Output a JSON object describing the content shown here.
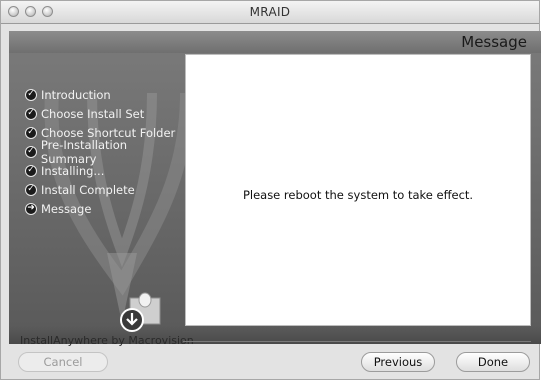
{
  "window": {
    "title": "MRAID"
  },
  "header": {
    "title": "Message"
  },
  "steps": [
    {
      "label": "Introduction",
      "state": "done"
    },
    {
      "label": "Choose Install Set",
      "state": "done"
    },
    {
      "label": "Choose Shortcut Folder",
      "state": "done"
    },
    {
      "label": "Pre-Installation Summary",
      "state": "done"
    },
    {
      "label": "Installing...",
      "state": "done"
    },
    {
      "label": "Install Complete",
      "state": "done"
    },
    {
      "label": "Message",
      "state": "current"
    }
  ],
  "content": {
    "message": "Please reboot the system to take effect."
  },
  "footer": {
    "brand": "InstallAnywhere by Macrovision",
    "cancel_label": "Cancel",
    "previous_label": "Previous",
    "done_label": "Done"
  },
  "icons": {
    "done": "check-circle-icon",
    "current": "arrow-circle-icon"
  }
}
